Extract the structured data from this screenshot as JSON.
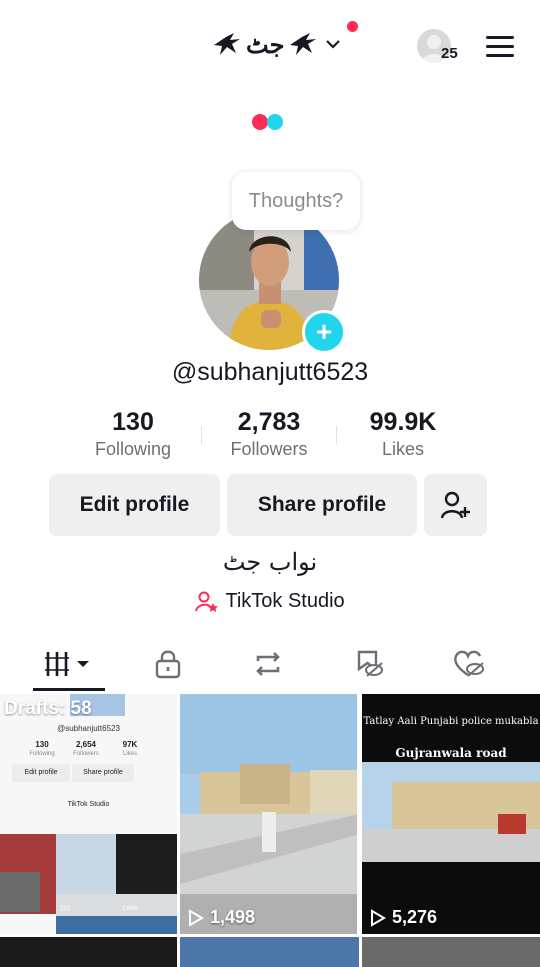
{
  "header": {
    "display_name": "جٹ",
    "friends_count": "25"
  },
  "profile": {
    "thoughts_placeholder": "Thoughts?",
    "username": "@subhanjutt6523",
    "stats": [
      {
        "value": "130",
        "label": "Following"
      },
      {
        "value": "2,783",
        "label": "Followers"
      },
      {
        "value": "99.9K",
        "label": "Likes"
      }
    ],
    "edit_label": "Edit profile",
    "share_label": "Share profile",
    "bio": "نواب جٹ",
    "studio_label": "TikTok Studio"
  },
  "tabs": [
    "videos",
    "private",
    "reposts",
    "favorites",
    "liked"
  ],
  "grid": {
    "drafts_label": "Drafts: 58",
    "draft_thumb": {
      "username": "@subhanjutt6523",
      "stats": [
        {
          "value": "130",
          "label": "Following"
        },
        {
          "value": "2,654",
          "label": "Followers"
        },
        {
          "value": "97K",
          "label": "Likes"
        }
      ],
      "edit": "Edit profile",
      "share": "Share profile",
      "studio": "TikTok Studio",
      "small_views": [
        "321",
        "1,668"
      ]
    },
    "videos": [
      {
        "views": "1,498"
      },
      {
        "views": "5,276",
        "caption_line1": "Tatlay Aali Punjabi police mukabla",
        "caption_line2": "Gujranwala road"
      }
    ]
  },
  "colors": {
    "accent_red": "#fe2c55",
    "accent_cyan": "#20d5ec",
    "button_bg": "#efeff0"
  }
}
